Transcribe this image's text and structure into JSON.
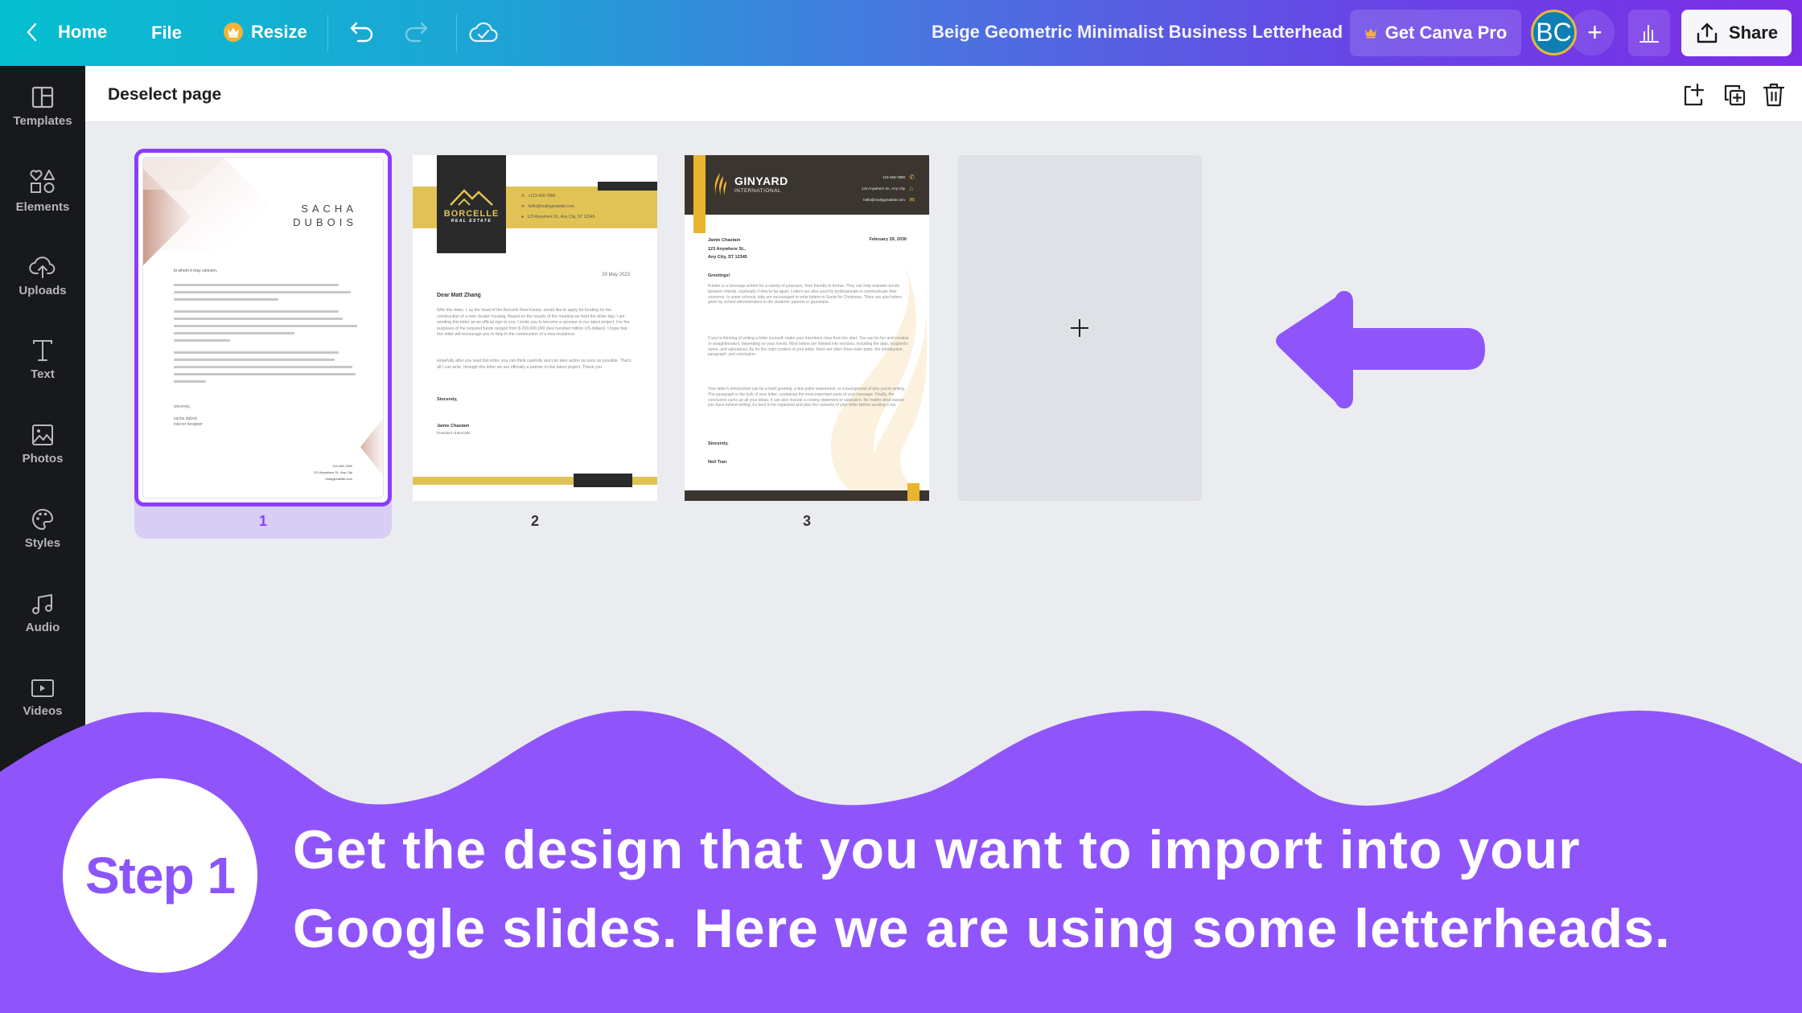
{
  "topbar": {
    "home_label": "Home",
    "file_label": "File",
    "resize_label": "Resize",
    "document_title": "Beige Geometric Minimalist Business Letterhead",
    "get_pro_label": "Get Canva Pro",
    "avatar_initials": "BC",
    "share_label": "Share"
  },
  "sidebar": {
    "items": [
      {
        "label": "Templates",
        "icon": "templates-icon"
      },
      {
        "label": "Elements",
        "icon": "elements-icon"
      },
      {
        "label": "Uploads",
        "icon": "upload-cloud-icon"
      },
      {
        "label": "Text",
        "icon": "text-icon"
      },
      {
        "label": "Photos",
        "icon": "photos-icon"
      },
      {
        "label": "Styles",
        "icon": "palette-icon"
      },
      {
        "label": "Audio",
        "icon": "music-note-icon"
      },
      {
        "label": "Videos",
        "icon": "video-icon"
      }
    ]
  },
  "pagebar": {
    "deselect_label": "Deselect page",
    "actions": [
      "add-page-icon",
      "duplicate-page-icon",
      "delete-page-icon"
    ]
  },
  "pages": [
    {
      "number": "1",
      "selected": true,
      "name_line1": "SACHA",
      "name_line2": "DUBOIS",
      "greeting": "to whom it may concern,",
      "signoff": "sincerely,",
      "signer": "sacha dubois",
      "signer_title": "interior designer",
      "contact": [
        "123-456-7890",
        "123 Anywhere St., Any City",
        "reallygreatsite.com"
      ]
    },
    {
      "number": "2",
      "selected": false,
      "brand": "BORCELLE",
      "brand_sub": "REAL ESTATE",
      "phone": "+123-456-7890",
      "email": "hello@reallygreatsite.com",
      "address": "123 Anywhere St., Any City, ST 12345",
      "date": "20 May 2023",
      "salutation": "Dear Matt Zhang",
      "body1": "With this letter, I, as the head of the Borcelle Real Estate, would like to apply for funding for the construction of a new cluster housing. Based on the results of the meeting we held the other day, I am sending this letter as an official sign to you. I invite you to become a sponsor in our latest project. For the purposes of the required funds ranged from $ 200,000,000 (two hundred million US dollars). I hope that this letter will encourage you to help in the construction of a new residence.",
      "body2": "Hopefully after you read this letter, you can think carefully and can take action as soon as possible. That's all I can write, through this letter we are officially a partner in this latest project. Thank you",
      "signoff": "Sincerely,",
      "signer": "Jamie Chastain",
      "signer_title": "President of Borcelle"
    },
    {
      "number": "3",
      "selected": false,
      "brand": "GINYARD",
      "brand_sub": "INTERNATIONAL",
      "phone": "123-456-7890",
      "address": "123 Anywhere St., Any City",
      "email": "hello@reallygreatsite.com",
      "sender": "Jamie Chastain",
      "sender_street": "123 Anywhere St.,",
      "sender_city": "Any City, ST 12345",
      "date": "February 29, 2030",
      "greeting": "Greetings!",
      "body1": "A letter is a message written for a variety of purposes, from friendly to formal. They can help maintain bonds between friends, especially if they're far apart. Letters are also used by professionals to communicate their concerns. In some schools, kids are encouraged to write letters to Santa for Christmas. There are also letters given by school administrators to the students' parents or guardians.",
      "body2": "If you're thinking of writing a letter yourself, make your intentions clear from the start. You can be fun and creative or straightforward, depending on your needs. Most letters are divided into sections, including the date, recipient's name, and salutations. As for the main content of your letter, there are often three main parts: the introduction, paragraph, and conclusion.",
      "body3": "Your letter's introduction can be a brief greeting, a few polite statements, or a background of why you're writing. The paragraph is the bulk of your letter, containing the most important parts of your message. Finally, the conclusion sums up all your ideas. It can also include a closing statement or salutation. No matter what reason you have behind writing, it's best to be organized and plan the contents of your letter before sending it out.",
      "signoff": "Sincerely,",
      "signer": "Neil Tran"
    }
  ],
  "add_page_symbol": "+",
  "tutorial": {
    "step_label": "Step 1",
    "caption_line1": "Get the design that you want to import into your",
    "caption_line2": "Google slides. Here we are using some letterheads.",
    "accent_color": "#8b55fb"
  },
  "colors": {
    "canva_purple": "#8b3dff",
    "selection_bg": "#d8cdf4",
    "sidebar_bg": "#18191b",
    "borcelle_yellow": "#e0c354",
    "ginyard_brown": "#3b3530",
    "ginyard_gold": "#e9b52f"
  }
}
